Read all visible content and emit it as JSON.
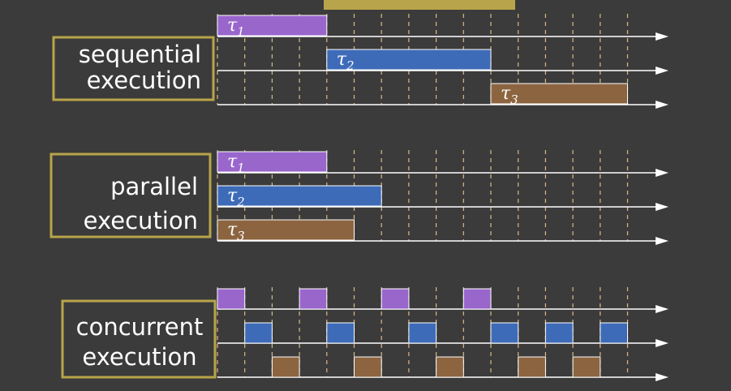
{
  "colors": {
    "background": "#3b3b3b",
    "frame": "#b8a44a",
    "axis": "#ffffff",
    "tick": "#d9b98a",
    "task1": "#9966cc",
    "task2": "#3e6bb8",
    "task3": "#8c6540",
    "text": "#ffffff"
  },
  "time_axis": {
    "start": 0,
    "end": 15,
    "ticks": [
      0,
      1,
      2,
      3,
      4,
      5,
      6,
      7,
      8,
      9,
      10,
      11,
      12,
      13,
      14,
      15
    ]
  },
  "panels": [
    {
      "id": "sequential",
      "label_lines": [
        "sequential",
        "execution"
      ],
      "rows": [
        {
          "task": "task1",
          "label": "τ",
          "sub": "1",
          "segments": [
            [
              0,
              4
            ]
          ]
        },
        {
          "task": "task2",
          "label": "τ",
          "sub": "2",
          "segments": [
            [
              4,
              10
            ]
          ]
        },
        {
          "task": "task3",
          "label": "τ",
          "sub": "3",
          "segments": [
            [
              10,
              15
            ]
          ]
        }
      ]
    },
    {
      "id": "parallel",
      "label_lines": [
        "parallel",
        "execution"
      ],
      "rows": [
        {
          "task": "task1",
          "label": "τ",
          "sub": "1",
          "segments": [
            [
              0,
              4
            ]
          ]
        },
        {
          "task": "task2",
          "label": "τ",
          "sub": "2",
          "segments": [
            [
              0,
              6
            ]
          ]
        },
        {
          "task": "task3",
          "label": "τ",
          "sub": "3",
          "segments": [
            [
              0,
              5
            ]
          ]
        }
      ]
    },
    {
      "id": "concurrent",
      "label_lines": [
        "concurrent",
        "execution"
      ],
      "rows": [
        {
          "task": "task1",
          "label": "",
          "sub": "",
          "segments": [
            [
              0,
              1
            ],
            [
              3,
              4
            ],
            [
              6,
              7
            ],
            [
              9,
              10
            ]
          ]
        },
        {
          "task": "task2",
          "label": "",
          "sub": "",
          "segments": [
            [
              1,
              2
            ],
            [
              4,
              5
            ],
            [
              7,
              8
            ],
            [
              10,
              11
            ],
            [
              12,
              13
            ],
            [
              14,
              15
            ]
          ]
        },
        {
          "task": "task3",
          "label": "",
          "sub": "",
          "segments": [
            [
              2,
              3
            ],
            [
              5,
              6
            ],
            [
              8,
              9
            ],
            [
              11,
              12
            ],
            [
              13,
              14
            ]
          ]
        }
      ]
    }
  ]
}
